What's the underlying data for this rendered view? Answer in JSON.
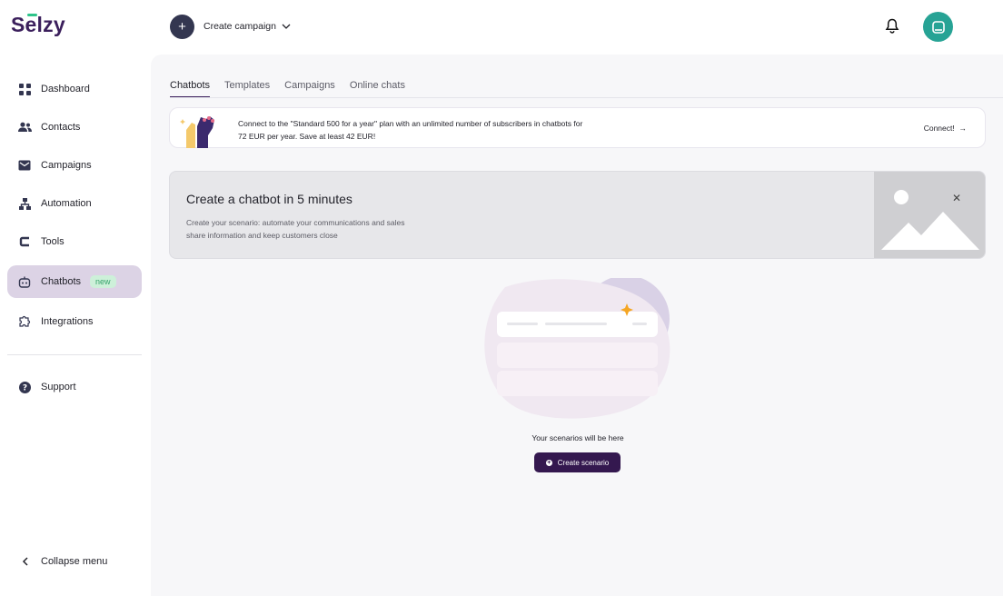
{
  "app": {
    "logo": "Selzy"
  },
  "header": {
    "create_campaign_label": "Create campaign",
    "create_icon_glyph": "+"
  },
  "sidebar": {
    "items": [
      {
        "label": "Dashboard",
        "icon": "grid-icon"
      },
      {
        "label": "Contacts",
        "icon": "people-icon"
      },
      {
        "label": "Campaigns",
        "icon": "mail-icon"
      },
      {
        "label": "Automation",
        "icon": "flow-icon"
      },
      {
        "label": "Tools",
        "icon": "tools-icon"
      },
      {
        "label": "Chatbots",
        "icon": "bot-icon",
        "badge": "new",
        "active": true
      },
      {
        "label": "Integrations",
        "icon": "puzzle-icon"
      }
    ],
    "support_label": "Support",
    "collapse_label": "Collapse menu"
  },
  "tabs": [
    {
      "label": "Chatbots",
      "active": true
    },
    {
      "label": "Templates"
    },
    {
      "label": "Campaigns"
    },
    {
      "label": "Online chats"
    }
  ],
  "promo": {
    "text": "Connect to the \"Standard 500 for a year\" plan with an unlimited number of subscribers in chatbots for 72 EUR per year. Save at least 42 EUR!",
    "link_label": "Connect!"
  },
  "banner": {
    "title": "Create a chatbot in 5 minutes",
    "subtitle_line1": "Create your scenario: automate your communications and sales",
    "subtitle_line2": "share information and keep customers close",
    "close_glyph": "✕"
  },
  "empty_state": {
    "text": "Your scenarios will be here",
    "button_label": "Create scenario"
  },
  "colors": {
    "brand": "#3b1f5c",
    "accent_green": "#2ec48a",
    "avatar": "#27a395",
    "active_nav": "#dcd3e5",
    "primary_button": "#34184f"
  }
}
